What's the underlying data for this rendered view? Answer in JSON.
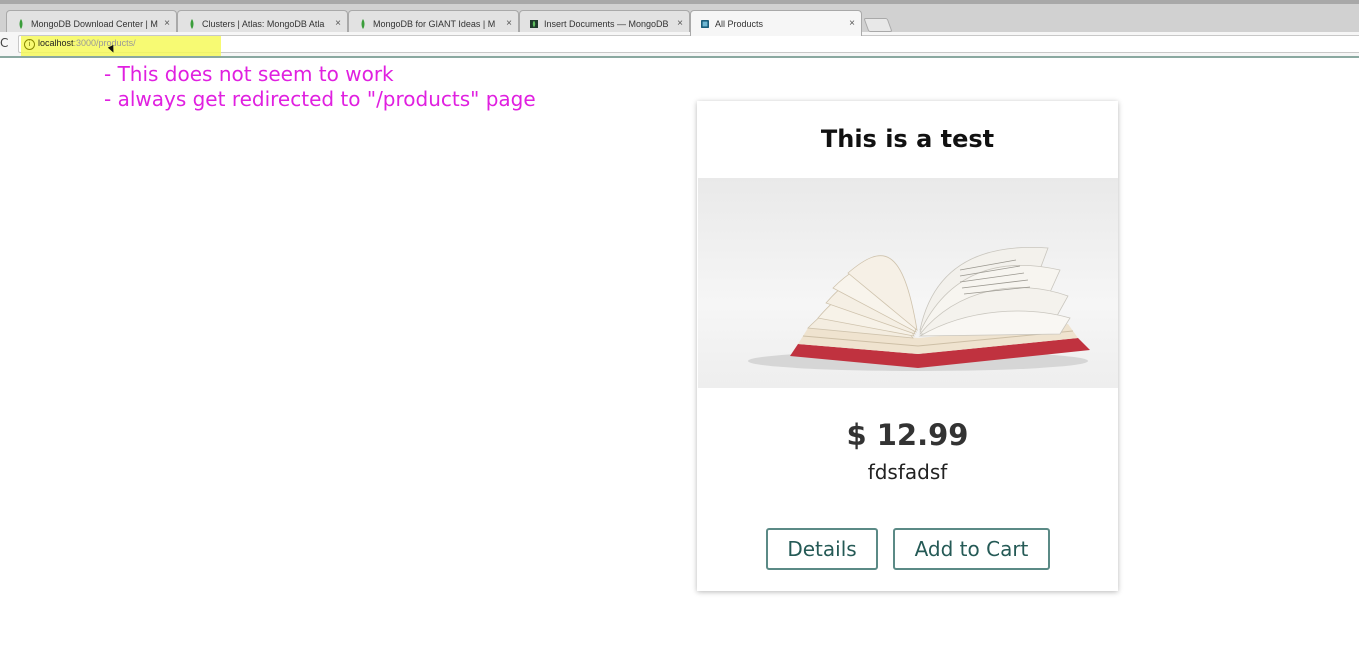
{
  "browser": {
    "tabs": [
      {
        "title": "MongoDB Download Center | M",
        "favicon": "mongodb-leaf-icon",
        "active": false
      },
      {
        "title": "Clusters | Atlas: MongoDB Atla",
        "favicon": "mongodb-leaf-icon",
        "active": false
      },
      {
        "title": "MongoDB for GIANT Ideas | M",
        "favicon": "mongodb-leaf-icon",
        "active": false
      },
      {
        "title": "Insert Documents — MongoDB",
        "favicon": "mongodb-docs-icon",
        "active": false
      },
      {
        "title": "All Products",
        "favicon": "app-icon",
        "active": true
      }
    ],
    "close_glyph": "×",
    "reload_glyph": "C",
    "url_host": "localhost",
    "url_path": ":3000/products/",
    "info_glyph": "i",
    "colors": {
      "highlight": "#f6f95a",
      "annotation": "#e020e0"
    }
  },
  "annotation": {
    "line1": "- This does not seem to work",
    "line2": "- always get redirected to \"/products\" page"
  },
  "product": {
    "title": "This is a test",
    "image": "open-book-image",
    "price": "$ 12.99",
    "description": "fdsfadsf",
    "details_label": "Details",
    "cart_label": "Add to Cart"
  }
}
